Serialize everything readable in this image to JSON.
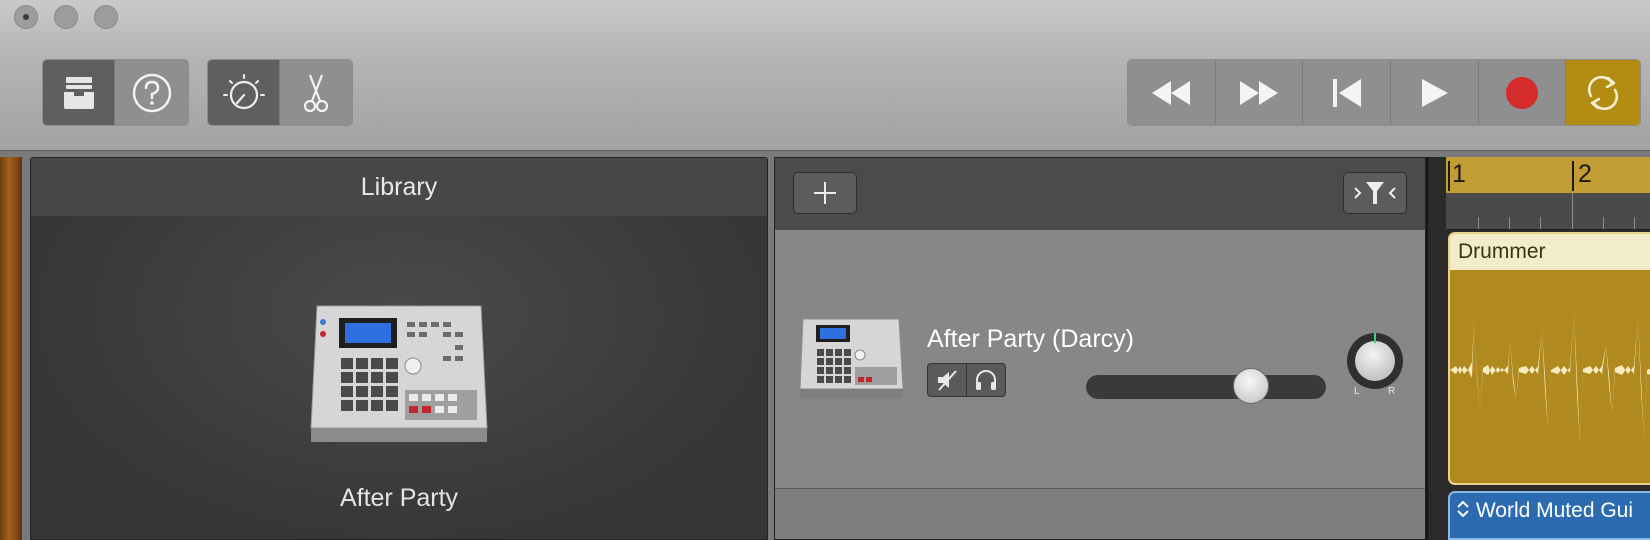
{
  "window": {
    "traffic_lights": [
      "close",
      "minimize",
      "zoom"
    ]
  },
  "toolbar": {
    "library_button_icon": "library-tray-icon",
    "help_button_icon": "question-circle-icon",
    "smart_controls_icon": "smart-controls-dial-icon",
    "editors_icon": "scissors-icon",
    "transport": {
      "rewind_icon": "rewind-icon",
      "fast_forward_icon": "fast-forward-icon",
      "go_to_beginning_icon": "skip-to-start-icon",
      "play_icon": "play-icon",
      "record_icon": "record-icon",
      "cycle_icon": "cycle-icon"
    }
  },
  "library": {
    "title": "Library",
    "selected_kit_name": "After Party",
    "kit_icon": "drum-machine-icon"
  },
  "tracks": {
    "add_track_icon": "plus-icon",
    "filter_icon": "filter-icon",
    "track": {
      "name": "After Party (Darcy)",
      "mute_icon": "mute-speaker-icon",
      "solo_icon": "headphones-icon",
      "volume": 0.72,
      "pan_left_label": "L",
      "pan_right_label": "R"
    }
  },
  "timeline": {
    "bars": [
      "1",
      "2"
    ],
    "regions": {
      "drummer": "Drummer",
      "guitar": "World Muted Gui"
    },
    "guitar_icon": "up-down-chevron-icon"
  },
  "colors": {
    "record": "#d62b2b",
    "cycle_active": "#b38c12",
    "drummer_region": "#b18a1f",
    "guitar_region": "#2c6bb0"
  }
}
